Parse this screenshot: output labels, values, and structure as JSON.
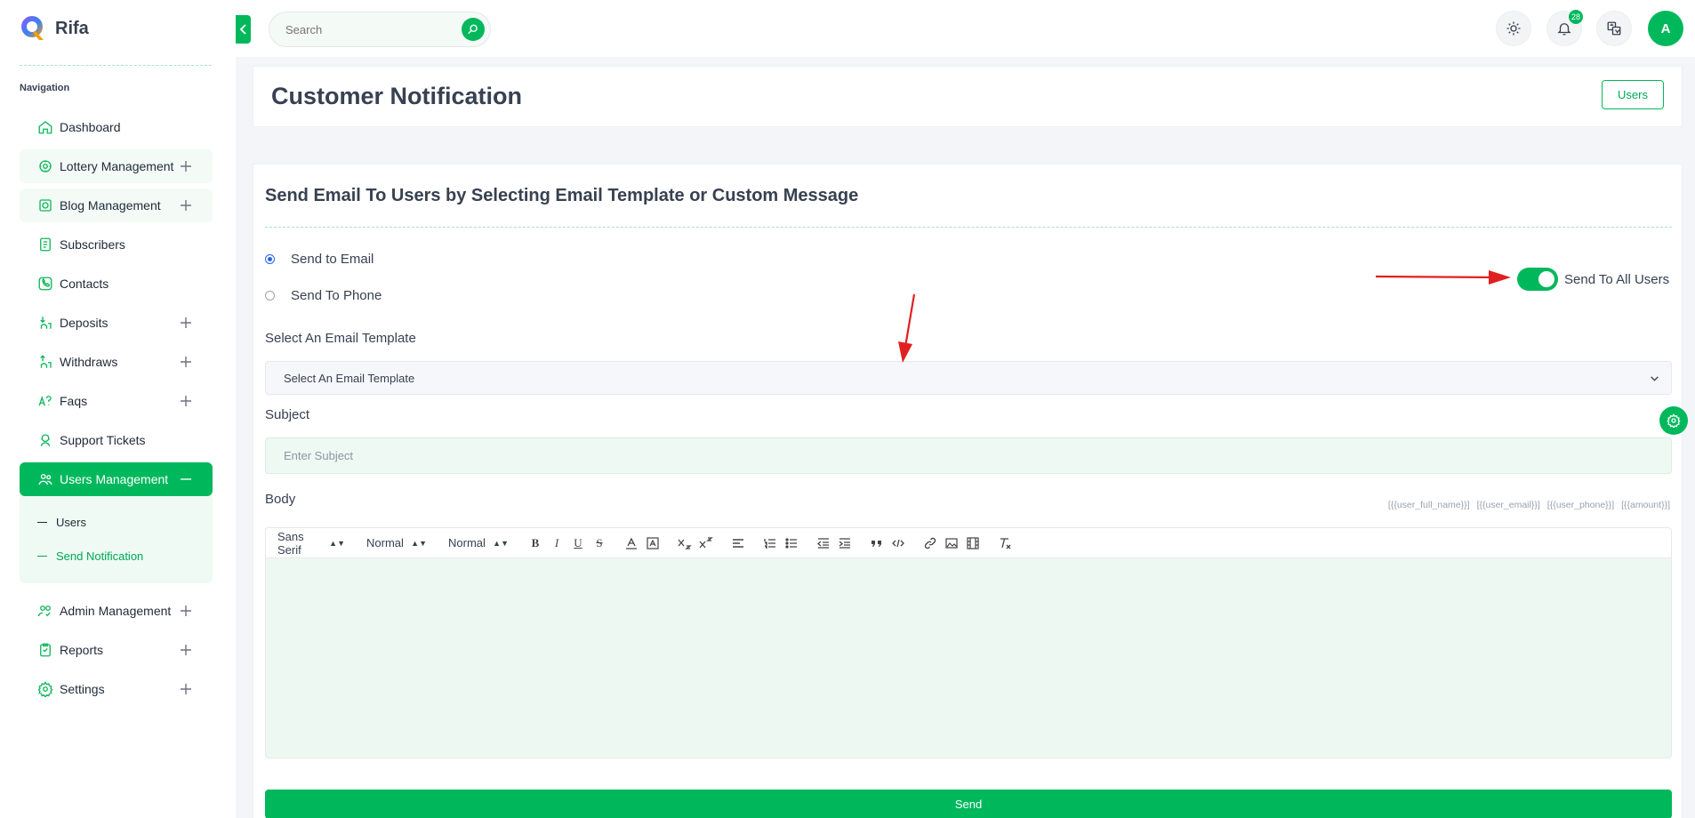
{
  "app": {
    "name": "Rifa"
  },
  "sidebar": {
    "title": "Navigation",
    "items": [
      {
        "label": "Dashboard",
        "icon": "home-icon"
      },
      {
        "label": "Lottery Management",
        "icon": "lottery-icon"
      },
      {
        "label": "Blog Management",
        "icon": "blog-icon"
      },
      {
        "label": "Subscribers",
        "icon": "subscribers-icon"
      },
      {
        "label": "Contacts",
        "icon": "contacts-icon"
      },
      {
        "label": "Deposits",
        "icon": "deposits-icon"
      },
      {
        "label": "Withdraws",
        "icon": "withdraws-icon"
      },
      {
        "label": "Faqs",
        "icon": "faqs-icon"
      },
      {
        "label": "Support Tickets",
        "icon": "support-icon"
      },
      {
        "label": "Users Management",
        "icon": "users-icon"
      },
      {
        "label": "Admin Management",
        "icon": "admin-icon"
      },
      {
        "label": "Reports",
        "icon": "reports-icon"
      },
      {
        "label": "Settings",
        "icon": "settings-icon"
      }
    ],
    "submenu": [
      {
        "label": "Users"
      },
      {
        "label": "Send Notification"
      }
    ]
  },
  "topbar": {
    "search_placeholder": "Search",
    "notification_count": "28",
    "avatar_initial": "A"
  },
  "header": {
    "title": "Customer Notification",
    "users_button": "Users"
  },
  "form": {
    "title": "Send Email To Users by Selecting Email Template or Custom Message",
    "radio_email": "Send to Email",
    "radio_phone": "Send To Phone",
    "toggle_label": "Send To All Users",
    "toggle_on": true,
    "template_label": "Select An Email Template",
    "template_value": "Select An Email Template",
    "subject_label": "Subject",
    "subject_placeholder": "Enter Subject",
    "body_label": "Body",
    "placeholders": [
      "[{{user_full_name}}]",
      "[{{user_email}}]",
      "[{{user_phone}}]",
      "[{{amount}}]"
    ],
    "toolbar": {
      "font": "Sans Serif",
      "size": "Normal",
      "heading": "Normal"
    },
    "send_button": "Send"
  },
  "colors": {
    "accent": "#00b85c",
    "annotation": "#e02020"
  }
}
